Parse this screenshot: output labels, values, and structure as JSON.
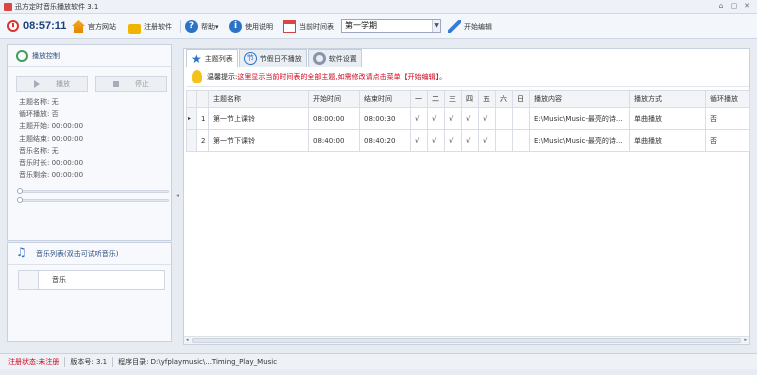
{
  "window": {
    "title": "迅方定时音乐播放软件 3.1",
    "controls": [
      "⌂",
      "▢",
      "✕"
    ]
  },
  "toolbar": {
    "clock": "08:57:11",
    "website": "官方网站",
    "register": "注册软件",
    "help": "帮助",
    "help_caret": "▾",
    "usage": "使用说明",
    "timetable": "当前时间表",
    "term": "第一学期",
    "edit": "开始编辑"
  },
  "player": {
    "header": "播放控制",
    "play": "播放",
    "stop": "停止",
    "lines": [
      "主题名称: 无",
      "循环播放: 否",
      "主题开始: 00:00:00",
      "主题结束: 00:00:00",
      "音乐名称: 无",
      "音乐时长: 00:00:00",
      "音乐剩余: 00:00:00"
    ]
  },
  "music_list": {
    "header": "音乐列表(双击可试听音乐)",
    "column": "音乐"
  },
  "tabs": [
    {
      "label": "主题列表",
      "active": true
    },
    {
      "label": "节假日不播放",
      "active": false
    },
    {
      "label": "软件设置",
      "active": false
    }
  ],
  "hint": {
    "label": "温馨提示:",
    "text": "这里显示当前时间表的全部主题,如需修改请点击菜单【开始编辑】。"
  },
  "grid": {
    "columns": [
      "主题名称",
      "开始时间",
      "结束时间",
      "一",
      "二",
      "三",
      "四",
      "五",
      "六",
      "日",
      "播放内容",
      "播放方式",
      "循环播放"
    ],
    "rows": [
      {
        "indicator": "▸",
        "num": "1",
        "cells": [
          "第一节上课铃",
          "08:00:00",
          "08:00:30",
          "√",
          "√",
          "√",
          "√",
          "√",
          "",
          "",
          "E:\\Music\\Music-最亮的诗...",
          "单曲播放",
          "否"
        ]
      },
      {
        "indicator": "",
        "num": "2",
        "cells": [
          "第一节下课铃",
          "08:40:00",
          "08:40:20",
          "√",
          "√",
          "√",
          "√",
          "√",
          "",
          "",
          "E:\\Music\\Music-最亮的诗...",
          "单曲播放",
          "否"
        ]
      }
    ]
  },
  "status": {
    "register_state": "注册状态:未注册",
    "version": "版本号: 3.1",
    "directory": "程序目录: D:\\yfplaymusic\\...Timing_Play_Music"
  },
  "colors": {
    "accent": "#2c72c7",
    "warning": "#d0021b",
    "clock": "#1d3f7a"
  }
}
